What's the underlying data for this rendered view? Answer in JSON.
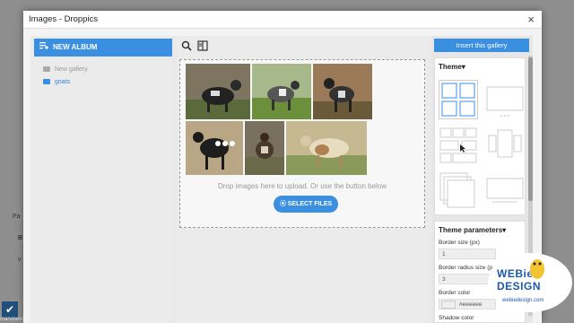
{
  "background": {
    "left_label_1": "Pa",
    "left_label_2": "B",
    "left_label_3": "v",
    "status_url": "marvinevius.com"
  },
  "modal": {
    "title": "Images - Droppics",
    "close_glyph": "×"
  },
  "left": {
    "new_album_label": "NEW ALBUM",
    "albums": [
      {
        "label": "New gallery",
        "active": false
      },
      {
        "label": "goats",
        "active": true
      }
    ]
  },
  "center": {
    "drop_text": "Drop images here to upload. Or use the button below",
    "select_files_label": "SELECT FILES",
    "thumbnails": [
      {
        "name": "goat-1",
        "bg": "#8a7a5a"
      },
      {
        "name": "goat-2",
        "bg": "#6f8a4a"
      },
      {
        "name": "goat-3",
        "bg": "#8a6e4a"
      },
      {
        "name": "goat-4",
        "bg": "#a0886a"
      },
      {
        "name": "goat-5",
        "bg": "#6a6a52"
      },
      {
        "name": "goat-6",
        "bg": "#9a9080"
      },
      {
        "name": "goat-7",
        "bg": "#b0a47a"
      }
    ]
  },
  "right": {
    "insert_label": "Insert this gallery",
    "theme_title": "Theme",
    "theme_params_title": "Theme parameters",
    "params": [
      {
        "label": "Border size (px)",
        "value": "1"
      },
      {
        "label": "Border radius size (p",
        "value": "3"
      },
      {
        "label": "Border color",
        "value": "#eeeeee"
      },
      {
        "label": "Shadow color",
        "value": ""
      }
    ]
  },
  "watermark": {
    "logo_text": "WEBie DESIGN",
    "url": "webiedesign.com"
  },
  "colors": {
    "accent": "#3b8fe0"
  }
}
